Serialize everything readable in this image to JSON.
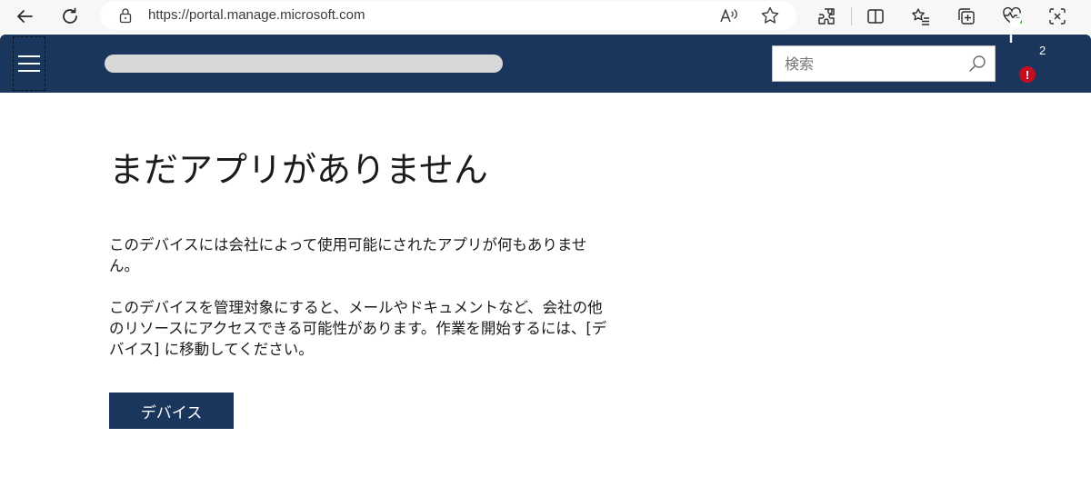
{
  "browser": {
    "url": "https://portal.manage.microsoft.com",
    "buttons": {
      "back": "back-arrow-icon",
      "refresh": "refresh-icon",
      "read_aloud": "read-aloud-icon",
      "favorite": "star-icon",
      "extensions": "extensions-icon",
      "split_screen": "split-screen-icon",
      "favorites": "favorites-list-icon",
      "collections": "collections-icon",
      "browser_essentials": "heartbeat-icon",
      "screenshot": "screenshot-icon"
    }
  },
  "header": {
    "search_placeholder": "検索",
    "notification_count": "2",
    "alert_mark": "!",
    "colors": {
      "background": "#1b365d",
      "alert": "#c50f1f"
    }
  },
  "main": {
    "title": "まだアプリがありません",
    "paragraph_1": "このデバイスには会社によって使用可能にされたアプリが何もありません。",
    "paragraph_2": "このデバイスを管理対象にすると、メールやドキュメントなど、会社の他のリソースにアクセスできる可能性があります。作業を開始するには、[デバイス] に移動してください。",
    "devices_button": "デバイス"
  }
}
